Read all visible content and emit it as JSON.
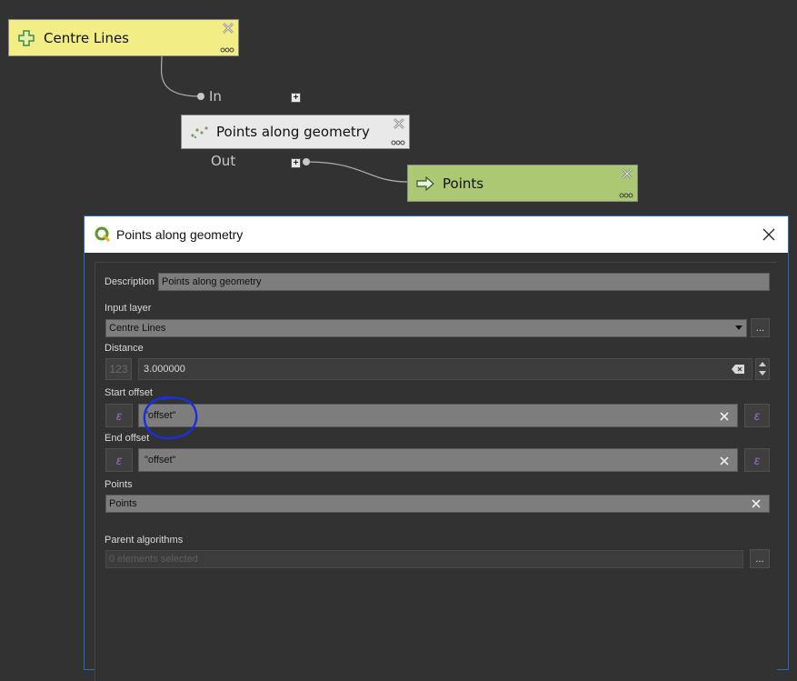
{
  "graph": {
    "input_node": {
      "label": "Centre Lines"
    },
    "algorithm_node": {
      "label": "Points along geometry",
      "port_in": "In",
      "port_out": "Out"
    },
    "output_node": {
      "label": "Points"
    }
  },
  "dialog": {
    "title": "Points along geometry",
    "fields": {
      "description": {
        "label": "Description",
        "value": "Points along geometry"
      },
      "input_layer": {
        "label": "Input layer",
        "value": "Centre Lines",
        "browse": "..."
      },
      "distance": {
        "label": "Distance",
        "value": "3.000000",
        "icon_text": "123"
      },
      "start_offset": {
        "label": "Start offset",
        "value": "\"offset\""
      },
      "end_offset": {
        "label": "End offset",
        "value": "\"offset\""
      },
      "points": {
        "label": "Points",
        "value": "Points"
      },
      "parent_algorithms": {
        "label": "Parent algorithms",
        "placeholder": "0 elements selected",
        "browse": "..."
      }
    }
  },
  "colors": {
    "canvas_bg": "#323232",
    "input_node": "#f2ed85",
    "algorithm_node": "#e9e9e9",
    "output_node": "#adc872",
    "annotation": "#1a2fe0"
  },
  "icons": {
    "input_node": "plus-cross-icon",
    "algorithm_node": "points-scatter-icon",
    "output_node": "arrow-right-icon",
    "dialog": "qgis-logo-icon"
  }
}
